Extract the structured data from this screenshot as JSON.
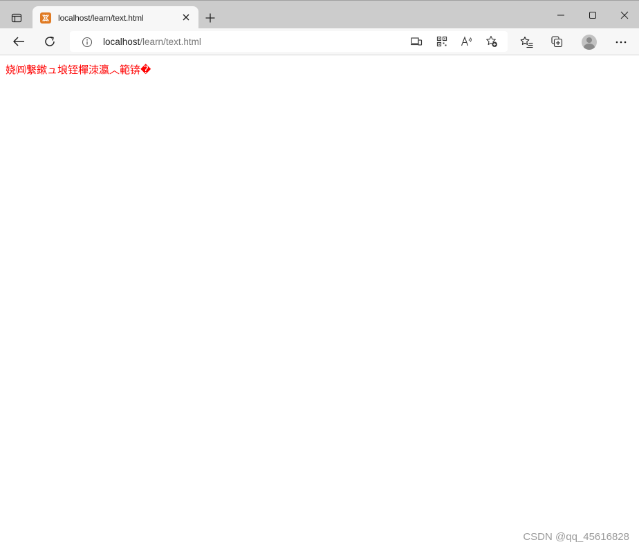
{
  "browser": {
    "tab": {
      "title": "localhost/learn/text.html"
    },
    "address": {
      "host": "localhost",
      "path": "/learn/text.html"
    },
    "icons": {
      "tab_actions": "tab-actions-icon",
      "favicon": "xampp-favicon",
      "tab_close": "close-icon",
      "new_tab": "plus-icon",
      "minimize": "minimize-icon",
      "maximize": "maximize-icon",
      "close_window": "close-icon",
      "back": "back-arrow-icon",
      "refresh": "refresh-icon",
      "site_info": "info-icon",
      "app_available": "app-available-icon",
      "qr_code": "qr-code-icon",
      "read_aloud": "read-aloud-icon",
      "add_favorite": "star-add-icon",
      "favorites": "favorites-icon",
      "collections": "collections-icon",
      "profile": "profile-avatar",
      "more": "more-icon"
    },
    "colors": {
      "tabstrip": "#cccccc",
      "toolbar": "#f7f7f7",
      "favicon": "#e07b24"
    }
  },
  "page": {
    "text": "娆㈣繋鏉ュ埌铚樿洓瀛︿範锛�",
    "text_color": "#ff0000"
  },
  "watermark": {
    "text": "CSDN @qq_45616828"
  }
}
